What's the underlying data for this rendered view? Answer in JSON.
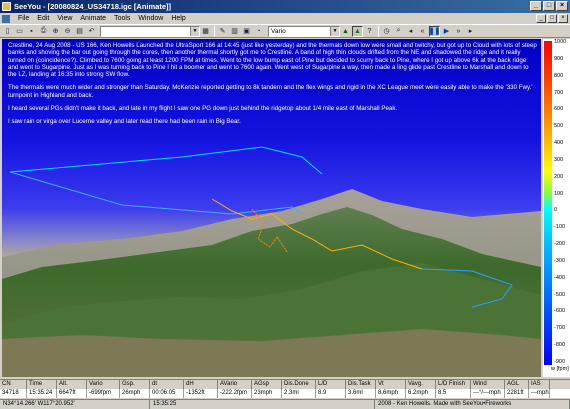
{
  "window": {
    "title": "SeeYou - [20080824_US34718.igc [Animate]]",
    "min": "_",
    "max": "□",
    "close": "×"
  },
  "menu": [
    "File",
    "Edit",
    "View",
    "Animate",
    "Tools",
    "Window",
    "Help"
  ],
  "toolbar": {
    "parameter_select": "Vario"
  },
  "flight_notes": [
    "Crestline, 24 Aug 2008 - US 166, Ken Howells\nLaunched the UltraSport 166 at 14:45 (just like yesterday) and the thermals down low were small and twitchy, but got up to Cloud with lots of steep banks and shoving the bar out going through the cores, then another thermal shortly got me to Crestline.  A band of high thin clouds drifted from the NE and shadowed the ridge and it really turned on (coincidence?).  Climbed to 7600 going at least 1200 FPM at times.  Went to the low bump east of Pine but decided to scurry back to Pine, where I got up above 6k at the back ridge and went to Sugarpine.  Just as I was turning back to Pine I hit a boomer and went to 7600 again.  Went west of Sugarpine a way, then made a ling glide past Crestline to Marshall and down to the LZ, landing at 16:35 into strong SW flow.",
    "The thermals were much wider and stronger than Saturday.  McKenzie reported getting to 8k tandem and the flex wings and rigid in the XC League meet were easily able to make the '330 Fwy.' turnpoint in Highland and back.",
    "I heard several PGs didn't make it back, and late in my flight I saw one PG down just behind the ridgetop about 1/4 mile east of Marshall Peak.",
    "I saw rain or virga over Lucerne valley and later read there had been rain in Big Bear."
  ],
  "vario_scale": {
    "ticks": [
      "1000",
      "900",
      "800",
      "700",
      "600",
      "500",
      "400",
      "300",
      "200",
      "100",
      "0",
      "-100",
      "-200",
      "-300",
      "-400",
      "-500",
      "-600",
      "-700",
      "-800",
      "-900"
    ],
    "unit": "w [fpm]"
  },
  "grid": {
    "headers": [
      "CN",
      "Time",
      "Alt.",
      "Vario",
      "Gsp.",
      "dt",
      "dH",
      "AVario",
      "AGsp",
      "Dis.Done",
      "L/D",
      "Dis.Task",
      "Vt",
      "Vavg.",
      "L/D Finish",
      "Wind",
      "AGL",
      "IAS"
    ],
    "row": [
      "34718",
      "15:35:24",
      "6647ft",
      "-699fpm",
      "26mph",
      "00:06:05",
      "-1352ft",
      "-222.2fpm",
      "23mph",
      "2.3ml",
      "8.9",
      "3.6ml",
      "8.6mph",
      "6.2mph",
      "8.5",
      "---°/---mph",
      "2281ft",
      "---mph"
    ]
  },
  "statusbar": {
    "coords": "N34°14.266' W117°20.952'",
    "time": "15:35:25",
    "credit": "2008 - Ken Howells. Made with SeeYou•Fireworks"
  },
  "colors": {
    "sky": "#0000c8",
    "titlebar": "#0a246a",
    "terrain": "#3f6a2e"
  }
}
